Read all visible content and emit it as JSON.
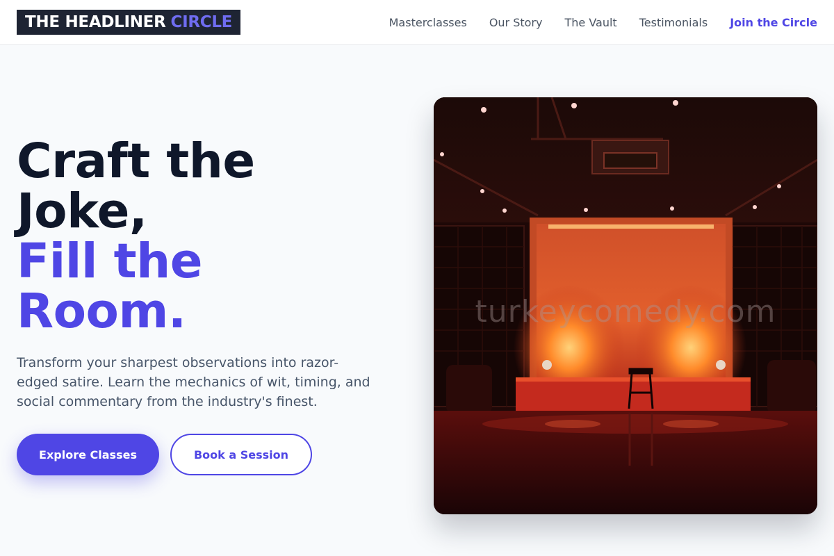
{
  "header": {
    "logo_main": "THE HEADLINER",
    "logo_accent": "CIRCLE",
    "nav": [
      {
        "label": "Masterclasses"
      },
      {
        "label": "Our Story"
      },
      {
        "label": "The Vault"
      },
      {
        "label": "Testimonials"
      },
      {
        "label": "Join the Circle"
      }
    ]
  },
  "hero": {
    "heading_lines": [
      "Craft the",
      "Joke,",
      "Fill the",
      "Room."
    ],
    "description": "Transform your sharpest observations into razor-edged satire. Learn the mechanics of wit, timing, and social commentary from the industry's finest.",
    "primary_button": "Explore Classes",
    "secondary_button": "Book a Session"
  },
  "image": {
    "watermark": "turkeycomedy.com"
  },
  "colors": {
    "accent": "#4f46e5",
    "dark_text": "#0f172a",
    "body_text": "#475569",
    "logo_bg": "#1e2433",
    "page_bg": "#f8fafc"
  }
}
